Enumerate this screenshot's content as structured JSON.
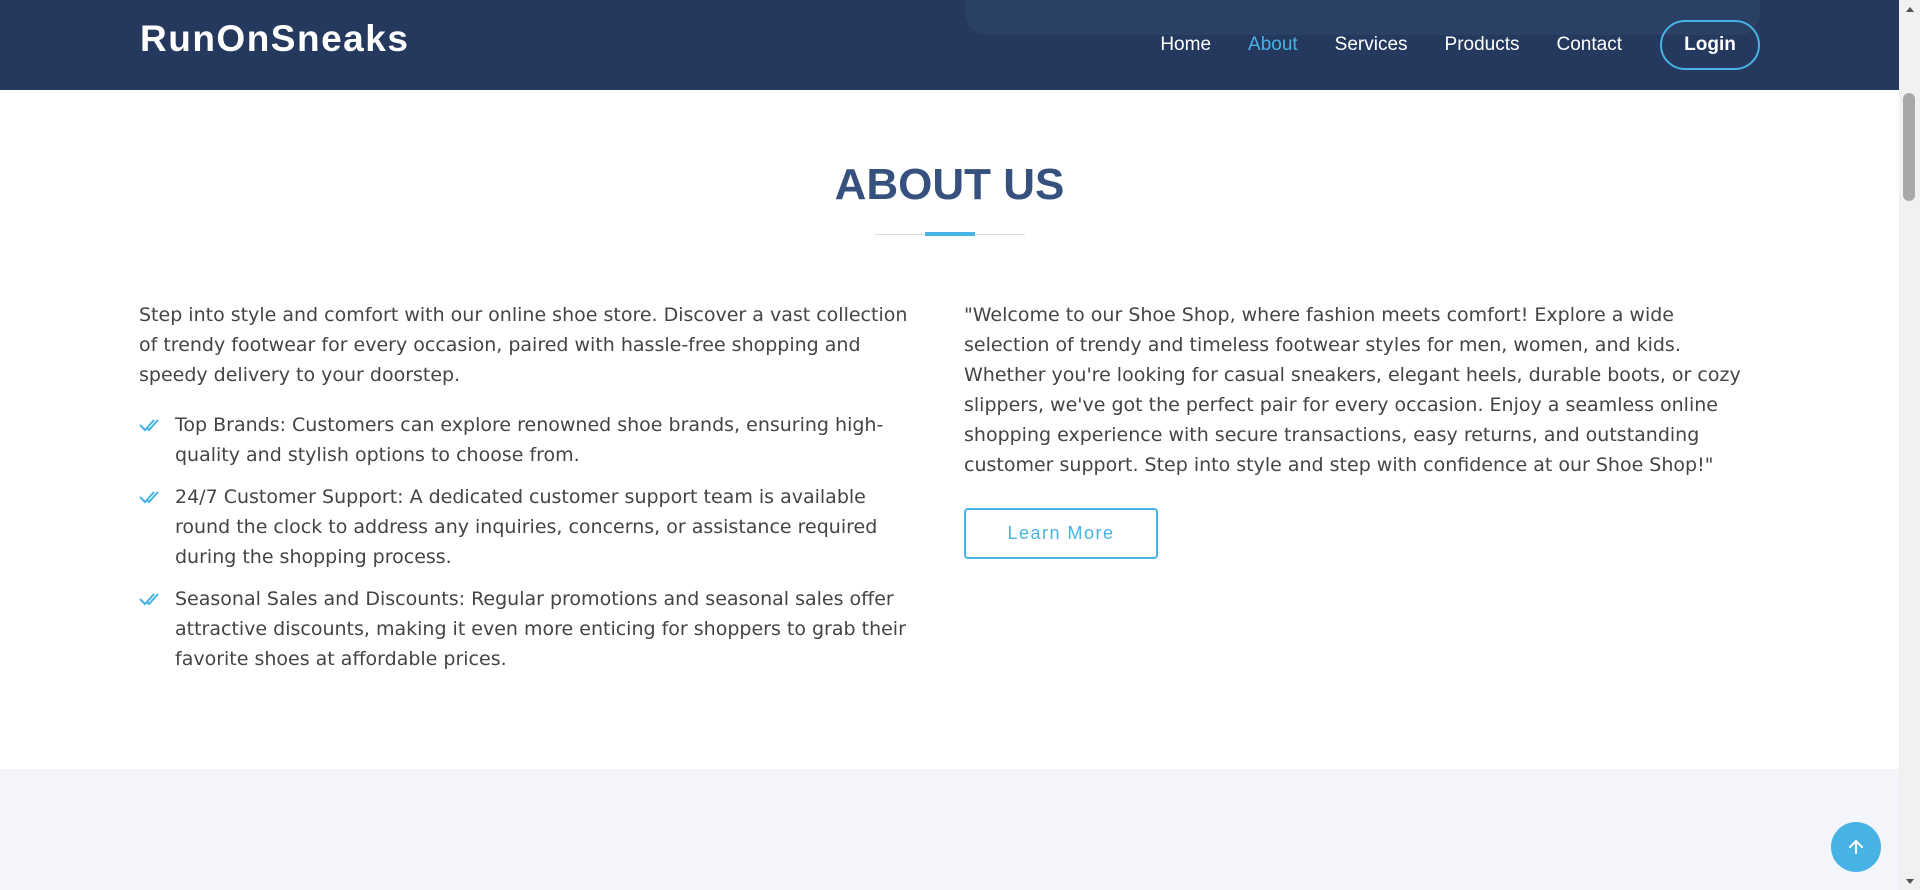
{
  "header": {
    "logo": "RunOnSneaks",
    "nav": [
      "Home",
      "About",
      "Services",
      "Products",
      "Contact"
    ],
    "active_nav": "About",
    "login_label": "Login"
  },
  "about": {
    "title": "ABOUT US",
    "intro": "Step into style and comfort with our online shoe store. Discover a vast collection of trendy footwear for every occasion, paired with hassle-free shopping and speedy delivery to your doorstep.",
    "features": [
      "Top Brands: Customers can explore renowned shoe brands, ensuring high-quality and stylish options to choose from.",
      "24/7 Customer Support: A dedicated customer support team is available round the clock to address any inquiries, concerns, or assistance required during the shopping process.",
      "Seasonal Sales and Discounts: Regular promotions and seasonal sales offer attractive discounts, making it even more enticing for shoppers to grab their favorite shoes at affordable prices."
    ],
    "quote": "\"Welcome to our Shoe Shop, where fashion meets comfort! Explore a wide selection of trendy and timeless footwear styles for men, women, and kids. Whether you're looking for casual sneakers, elegant heels, durable boots, or cozy slippers, we've got the perfect pair for every occasion. Enjoy a seamless online shopping experience with secure transactions, easy returns, and outstanding customer support. Step into style and step with confidence at our Shoe Shop!\"",
    "learn_more_label": "Learn More"
  },
  "icons": {
    "feature_bullet": "double-check-icon",
    "back_to_top": "arrow-up-icon"
  },
  "colors": {
    "header_bg": "#25395e",
    "accent": "#47b2e4",
    "title": "#37517e",
    "section_alt_bg": "#f3f5fa"
  }
}
